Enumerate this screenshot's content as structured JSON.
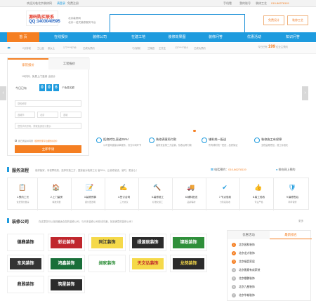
{
  "topbar": {
    "welcome": "欢迎光临北京装修网",
    "login": "请登录",
    "register": "免费注册",
    "mobile": "手机看",
    "my_account": "我的账号",
    "quote": "装修工艺",
    "phone": "010-86278119"
  },
  "header": {
    "logo_line1": "源码购买联系",
    "logo_line2": "QQ:1403040595",
    "slogan1": "北京装修网",
    "slogan2": "北京一站式装修服务平台",
    "btn_design": "免费设计",
    "btn_quote": "装修工艺"
  },
  "nav": [
    "首 页",
    "在线报价",
    "装修公司",
    "在建工地",
    "装修效果图",
    "装修问答",
    "优惠活动",
    "知识问答"
  ],
  "ticker": {
    "items": [
      "2分钟前",
      "兰山区",
      "张女士",
      "177****8766",
      "已成功预约",
      "7分钟前",
      "兰陵县",
      "王先生",
      "137****7816",
      "已成功预约"
    ],
    "visits_prefix": "今日已有",
    "visits_count": "199",
    "visits_suffix": "位业主预约"
  },
  "form": {
    "tab1": "家装报价",
    "tab2": "工装报价",
    "counter_prefix": "今日已有",
    "digits": [
      "0",
      "0",
      "6"
    ],
    "counter_suffix": "个免费名额",
    "intro": "10秒钟，免费上门量房 出设计",
    "f_name": "您的称呼",
    "f_city": "选城市",
    "f_area": "北京",
    "f_house": "选城",
    "f_phone": "手机号码",
    "f_tip": "您的手机号码，获取免费设计报价",
    "agree": "我已阅读并同意",
    "agree_link": "《装修管家平台服务条款》",
    "submit": "立即申请"
  },
  "features": [
    {
      "title": "拒绝转包,直省35%！",
      "desc": "公司官网直接派单服务，省去中间环节"
    },
    {
      "title": "装修满意再付款",
      "desc": "装修资金第三方监管，验收后再付款"
    },
    {
      "title": "辅料统一配送",
      "desc": "所有辅材统一配送，品质保证"
    },
    {
      "title": "装修施工有保障",
      "desc": "全程监理把控，施工标准化"
    }
  ],
  "service": {
    "title": "服务流程",
    "desc": "装修管家，有保障机制，选择好施工方，直接面对装修工长 省35%，让装修省钱、省时、更省心！",
    "phone_label": "电话预约：",
    "phone": "010-86278119",
    "online": "排在网上预约",
    "steps": [
      {
        "icon": "📋",
        "title": "1.预约工长",
        "desc": "免费预约量房"
      },
      {
        "icon": "🏠",
        "title": "2.上门量房",
        "desc": "精准测量"
      },
      {
        "icon": "📝",
        "title": "3.装修预算",
        "desc": "报价更透明"
      },
      {
        "icon": "✍",
        "title": "4.签订合同",
        "desc": "三方协议"
      },
      {
        "icon": "🔨",
        "title": "5.装修施工",
        "desc": "标准化施工"
      },
      {
        "icon": "🚚",
        "title": "6.辅料配送",
        "desc": "品牌辅材"
      },
      {
        "icon": "✔",
        "title": "7.节点验收",
        "desc": "分阶段验收"
      },
      {
        "icon": "👍",
        "title": "8.竣工验收",
        "desc": "专业严格"
      },
      {
        "icon": "🛡",
        "title": "9.保修售后",
        "desc": "两年保修"
      }
    ]
  },
  "companies": {
    "title": "装修公司",
    "desc": "在这里您可以找到最适合您的装修公司，与众多装修公司在线沟通，找到满意的装修公司！",
    "more": "更多",
    "logos": [
      {
        "name": "德鼎装饰",
        "color": "#222",
        "bg": "#fff"
      },
      {
        "name": "彩云装饰",
        "color": "#fff",
        "bg": "#c0272d"
      },
      {
        "name": "同江装饰",
        "color": "#333",
        "bg": "#f5d94a"
      },
      {
        "name": "绿源居装饰",
        "color": "#fff",
        "bg": "#2b2b2b"
      },
      {
        "name": "锦致装饰",
        "color": "#fff",
        "bg": "#2f8f3a"
      },
      {
        "name": "东风装饰",
        "color": "#fff",
        "bg": "#333"
      },
      {
        "name": "鸿鑫装饰",
        "color": "#fff",
        "bg": "#1a6f3a"
      },
      {
        "name": "阔家装饰",
        "color": "#2f8f3a",
        "bg": "#fff"
      },
      {
        "name": "天文弘装饰",
        "color": "#c0272d",
        "bg": "#f5d94a"
      },
      {
        "name": "龙然装饰",
        "color": "#f5d94a",
        "bg": "#2b2b2b"
      },
      {
        "name": "鼎雅装饰",
        "color": "#333",
        "bg": "#fff"
      },
      {
        "name": "筑星装饰",
        "color": "#fff",
        "bg": "#2b2b2b"
      }
    ]
  },
  "ranking": {
    "tab1": "优惠活动",
    "tab2": "最新排名",
    "items": [
      "北京昌和装饰",
      "北京龙大装饰",
      "北京福音家居",
      "北京雅意有成家装",
      "北京鼎鹏装饰",
      "北京九星装饰",
      "北京华城装饰"
    ]
  },
  "colors": {
    "primary": "#1e9bde",
    "accent": "#f57f22"
  }
}
